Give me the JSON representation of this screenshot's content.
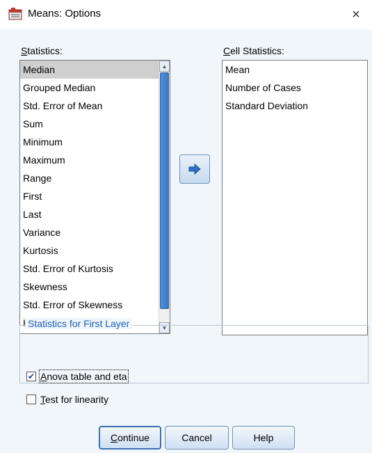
{
  "window": {
    "title": "Means: Options",
    "close_glyph": "×",
    "icon": "spss-means-app-icon"
  },
  "statistics": {
    "label_mnemonic": "S",
    "label_rest": "tatistics:",
    "items": [
      "Median",
      "Grouped Median",
      "Std. Error of Mean",
      "Sum",
      "Minimum",
      "Maximum",
      "Range",
      "First",
      "Last",
      "Variance",
      "Kurtosis",
      "Std. Error of Kurtosis",
      "Skewness",
      "Std. Error of Skewness",
      "Harmonic Mean"
    ],
    "selected": "Median"
  },
  "cell_statistics": {
    "label_mnemonic": "C",
    "label_rest": "ell Statistics:",
    "items": [
      "Mean",
      "Number of Cases",
      "Standard Deviation"
    ]
  },
  "move_button": {
    "icon": "arrow-right-icon"
  },
  "first_layer": {
    "title": "Statistics for First Layer",
    "anova": {
      "mnemonic": "A",
      "rest": "nova table and eta",
      "checked": true
    },
    "linearity": {
      "mnemonic": "T",
      "rest": "est for linearity",
      "checked": false
    }
  },
  "buttons": {
    "continue_mnemonic": "C",
    "continue_rest": "ontinue",
    "cancel": "Cancel",
    "help": "Help"
  },
  "colors": {
    "dialog_background": "#f1f6fb",
    "group_title": "#1a5fb4",
    "scroll_thumb": "#3a78c8",
    "selection": "#cfcfcf"
  }
}
